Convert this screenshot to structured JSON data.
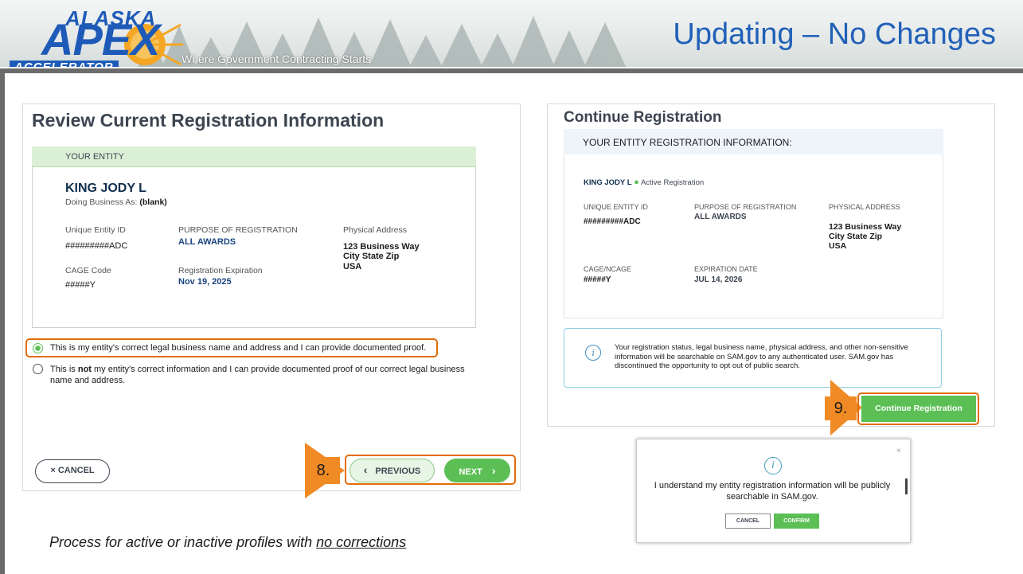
{
  "header": {
    "logo_alaska": "ALASKA",
    "logo_apex": "APEX",
    "logo_accelerator": "ACCELERATOR",
    "tagline": "Where Government Contracting Starts",
    "slide_title": "Updating – No Changes"
  },
  "review": {
    "title": "Review Current Registration Information",
    "entity_section": "YOUR ENTITY",
    "entity_name": "KING JODY L",
    "dba_label": "Doing Business As:",
    "dba_value": "(blank)",
    "uei_label": "Unique Entity ID",
    "uei_value": "#########ADC",
    "purpose_label": "PURPOSE OF REGISTRATION",
    "purpose_value": "ALL AWARDS",
    "address_label": "Physical Address",
    "address_line1": "123 Business Way",
    "address_line2": "City State Zip",
    "address_line3": "USA",
    "cage_label": "CAGE Code",
    "cage_value": "#####Y",
    "expiration_label": "Registration Expiration",
    "expiration_value": "Nov 19, 2025",
    "option_correct": "This is my entity's correct legal business name and address and I can provide documented proof.",
    "option_incorrect_pre": "This is ",
    "option_incorrect_bold": "not",
    "option_incorrect_post": " my entity's correct information and I can provide documented proof of our correct legal business name and address.",
    "cancel_label": "× CANCEL",
    "previous_label": "PREVIOUS",
    "next_label": "NEXT"
  },
  "callouts": {
    "step8": "8.",
    "step9": "9."
  },
  "continue": {
    "title": "Continue Registration",
    "section": "YOUR ENTITY REGISTRATION INFORMATION:",
    "entity_name": "KING JODY L",
    "status": "Active Registration",
    "uei_label": "UNIQUE ENTITY ID",
    "uei_value": "#########ADC",
    "purpose_label": "PURPOSE OF REGISTRATION",
    "purpose_value": "ALL AWARDS",
    "address_label": "PHYSICAL ADDRESS",
    "address_line1": "123 Business Way",
    "address_line2": "City State Zip",
    "address_line3": "USA",
    "cage_label": "CAGE/NCAGE",
    "cage_value": "#####Y",
    "expiration_label": "EXPIRATION DATE",
    "expiration_value": "JUL 14, 2026",
    "info_text": "Your registration status, legal business name, physical address, and other non-sensitive information will be searchable on SAM.gov to any authenticated user. SAM.gov has discontinued the opportunity to opt out of public search.",
    "button_label": "Continue Registration"
  },
  "modal": {
    "close": "×",
    "text": "I understand my entity registration information will be publicly searchable in SAM.gov.",
    "cancel_label": "CANCEL",
    "confirm_label": "CONFIRM"
  },
  "footnote": {
    "pre": "Process for active or inactive profiles with ",
    "underlined": "no corrections"
  },
  "colors": {
    "accent_green": "#5bbf55",
    "callout_orange": "#f08a24",
    "title_blue": "#2160b8"
  }
}
